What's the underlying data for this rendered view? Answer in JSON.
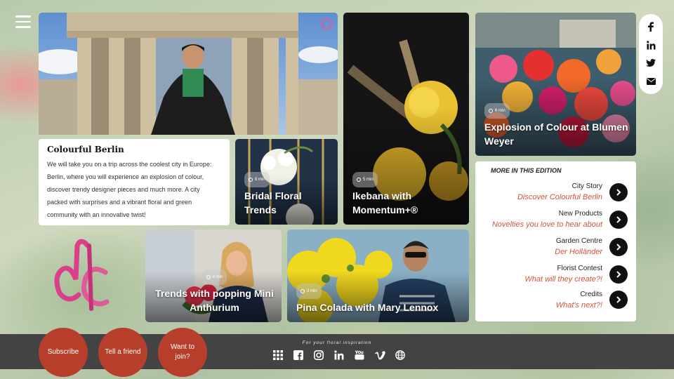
{
  "brand_colors": {
    "accent": "#b83e2c",
    "link": "#d0553b",
    "footer": "#434343"
  },
  "intro": {
    "title": "Colourful Berlin",
    "body": "We will take you on a trip across the coolest city in Europe: Berlin, where you will experience an explosion of colour, discover trendy designer pieces and much more. A city packed with surprises and a vibrant floral and green community with an innovative twist!"
  },
  "tiles": {
    "bridal": {
      "badge": "6 min",
      "title": "Bridal Floral Trends"
    },
    "ikebana": {
      "badge": "5 min",
      "title": "Ikebana with Momentum+®"
    },
    "explosion": {
      "badge": "6 min",
      "title": "Explosion of Colour at Blumen Weyer"
    },
    "anthurium": {
      "badge": "4 min",
      "title": "Trends with popping Mini Anthurium"
    },
    "pina": {
      "badge": "3 min",
      "title": "Pina Colada with Mary Lennox"
    }
  },
  "more": {
    "heading": "MORE IN THIS EDITION",
    "items": [
      {
        "label": "City Story",
        "link": "Discover Colourful Berlin"
      },
      {
        "label": "New Products",
        "link": "Novelties you love to hear about"
      },
      {
        "label": "Garden Centre",
        "link": "Der Holländer"
      },
      {
        "label": "Florist Contest",
        "link": "What will they create?!"
      },
      {
        "label": "Credits",
        "link": "What's next?!"
      }
    ]
  },
  "social_icons": [
    "facebook-icon",
    "linkedin-icon",
    "twitter-icon",
    "mail-icon"
  ],
  "footer": {
    "tagline": "For your floral inspiration",
    "buttons": {
      "subscribe": "Subscribe",
      "tell": "Tell a friend",
      "join": "Want to join?"
    },
    "icons": [
      "grid-icon",
      "facebook-icon",
      "instagram-icon",
      "linkedin-icon",
      "youtube-icon",
      "vimeo-icon",
      "globe-icon"
    ]
  }
}
